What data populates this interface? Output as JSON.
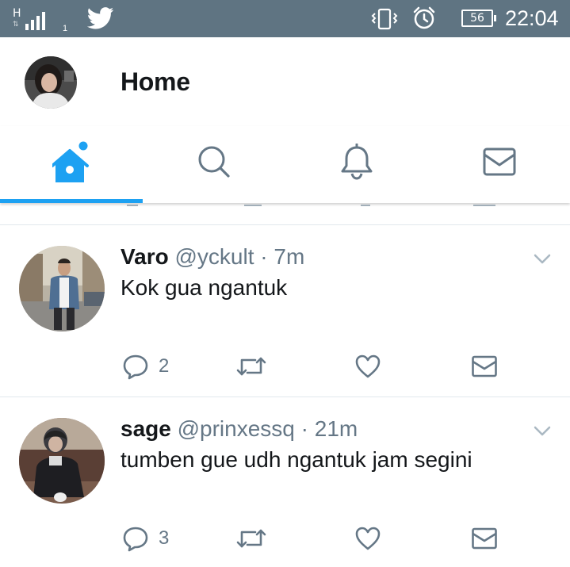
{
  "status_bar": {
    "network_type": "H",
    "sim_slot": "1",
    "battery_level": "56",
    "time": "22:04",
    "icons": [
      "signal-icon",
      "twitter-bird-icon",
      "vibrate-icon",
      "alarm-icon",
      "battery-icon"
    ]
  },
  "header": {
    "title": "Home"
  },
  "tabs": [
    {
      "name": "home",
      "icon": "home-icon",
      "active": true,
      "has_badge": true
    },
    {
      "name": "search",
      "icon": "search-icon",
      "active": false
    },
    {
      "name": "notifications",
      "icon": "bell-icon",
      "active": false
    },
    {
      "name": "messages",
      "icon": "mail-icon",
      "active": false
    }
  ],
  "colors": {
    "status_bar": "#5f7482",
    "accent": "#1da1f2",
    "text_primary": "#14171a",
    "text_secondary": "#657786",
    "divider": "#e1e8ed"
  },
  "tweets": [
    {
      "name": "Varo",
      "handle": "@yckult",
      "separator": "·",
      "time": "7m",
      "text": "Kok gua ngantuk",
      "reply_count": "2"
    },
    {
      "name": "sage",
      "handle": "@prinxessq",
      "separator": "·",
      "time": "21m",
      "text": "tumben gue udh ngantuk jam segini",
      "reply_count": "3"
    }
  ]
}
